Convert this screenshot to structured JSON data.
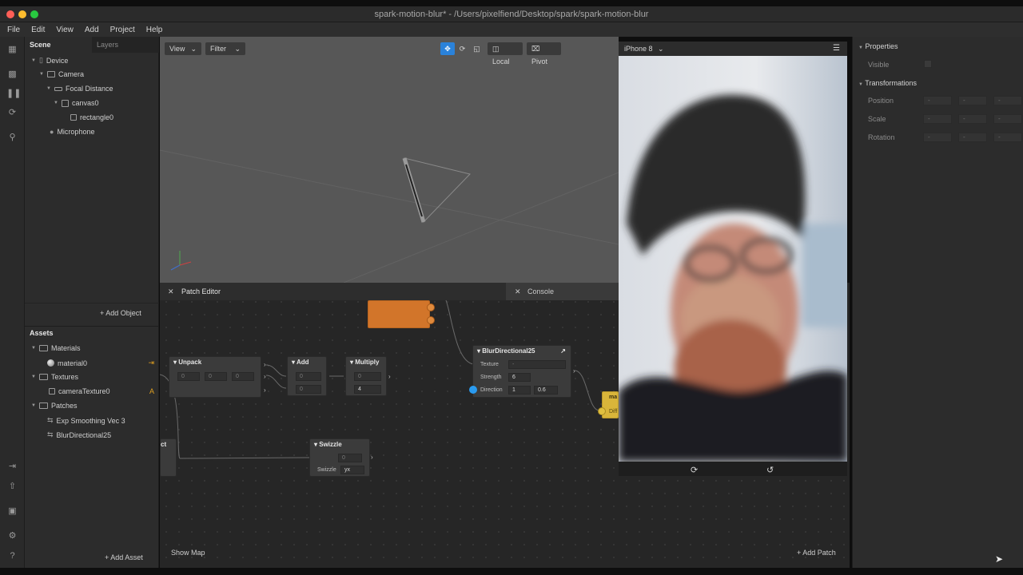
{
  "window": {
    "title": "spark-motion-blur* - /Users/pixelfiend/Desktop/spark/spark-motion-blur"
  },
  "menu": [
    "File",
    "Edit",
    "View",
    "Add",
    "Project",
    "Help"
  ],
  "scene_panel": {
    "tabs": [
      "Scene",
      "Layers"
    ],
    "tree": [
      {
        "label": "Device"
      },
      {
        "label": "Camera"
      },
      {
        "label": "Focal Distance"
      },
      {
        "label": "canvas0"
      },
      {
        "label": "rectangle0"
      },
      {
        "label": "Microphone"
      }
    ],
    "add_object": "Add Object"
  },
  "assets_panel": {
    "title": "Assets",
    "groups": [
      {
        "label": "Materials",
        "items": [
          {
            "label": "material0",
            "badge": "⇥"
          }
        ]
      },
      {
        "label": "Textures",
        "items": [
          {
            "label": "cameraTexture0",
            "badge": "A"
          }
        ]
      },
      {
        "label": "Patches",
        "items": [
          {
            "label": "Exp Smoothing Vec 3"
          },
          {
            "label": "BlurDirectional25"
          }
        ]
      }
    ],
    "add_asset": "Add Asset"
  },
  "viewport": {
    "view_label": "View",
    "filter_label": "Filter",
    "local_label": "Local",
    "pivot_label": "Pivot"
  },
  "patch_editor": {
    "tab": "Patch Editor",
    "console_tab": "Console",
    "show_map": "Show Map",
    "add_patch": "Add Patch",
    "nodes": {
      "unpack": {
        "title": "Unpack",
        "f1": "0",
        "f2": "0",
        "f3": "0"
      },
      "add": {
        "title": "Add",
        "f1": "0",
        "f2": "0"
      },
      "multiply": {
        "title": "Multiply",
        "f1": "0",
        "f2": "4"
      },
      "blur": {
        "title": "BlurDirectional25",
        "texture": "Texture",
        "texture_val": "-",
        "strength": "Strength",
        "strength_val": "6",
        "direction": "Direction",
        "dir_x": "1",
        "dir_y": "0.6"
      },
      "swizzle": {
        "title": "Swizzle",
        "f1": "0",
        "swizzle_label": "Swizzle",
        "swizzle_val": "yx"
      },
      "partial_left": {
        "title": "ct"
      },
      "partial_right": {
        "title": "ma",
        "sub": "Diff"
      }
    }
  },
  "phone": {
    "device": "iPhone 8"
  },
  "properties": {
    "title": "Properties",
    "visible": "Visible",
    "transformations": "Transformations",
    "rows": [
      "Position",
      "Scale",
      "Rotation"
    ],
    "dash": "-"
  }
}
